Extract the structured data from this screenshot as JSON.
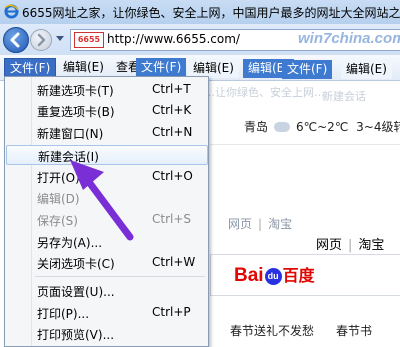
{
  "window": {
    "title": "6655网址之家，让你绿色、安全上网，中国用户最多的网址大全网站之一"
  },
  "addressbar": {
    "favicon_text": "6655",
    "url": "http://www.6655.com/",
    "watermark": "win7china.com"
  },
  "menubar": {
    "file": "文件(F)",
    "edit": "编辑(E)",
    "view": "查看",
    "ghost_file": "文件(F)",
    "ghost_edit_1": "编辑(E)",
    "ghost_edit_2": "编辑(E)",
    "ghost_file_2": "文件(F)",
    "ghost_edit_3": "编辑(E)"
  },
  "file_menu": {
    "items": [
      {
        "label": "新建选项卡(T)",
        "shortcut": "Ctrl+T",
        "disabled": false
      },
      {
        "label": "重复选项卡(B)",
        "shortcut": "Ctrl+K",
        "disabled": false
      },
      {
        "label": "新建窗口(N)",
        "shortcut": "Ctrl+N",
        "disabled": false
      },
      {
        "label": "新建会话(I)",
        "shortcut": "",
        "disabled": false,
        "highlighted": true
      },
      {
        "label": "打开(O)...",
        "shortcut": "Ctrl+O",
        "disabled": false
      },
      {
        "label": "编辑(D)",
        "shortcut": "",
        "disabled": true
      },
      {
        "label": "保存(S)",
        "shortcut": "Ctrl+S",
        "disabled": true
      },
      {
        "label": "另存为(A)...",
        "shortcut": "",
        "disabled": false
      },
      {
        "label": "关闭选项卡(C)",
        "shortcut": "Ctrl+W",
        "disabled": false
      },
      {
        "label": "页面设置(U)...",
        "shortcut": "",
        "disabled": false
      },
      {
        "label": "打印(P)...",
        "shortcut": "Ctrl+P",
        "disabled": false
      },
      {
        "label": "打印预览(V)...",
        "shortcut": "",
        "disabled": false
      }
    ]
  },
  "page": {
    "faint_text_1": "…让你绿色、安全上网…",
    "faint_text_2": "新建会话",
    "weather_city": "青岛",
    "weather_temp": "6℃~2℃",
    "weather_wind": "3~4级转",
    "tab_web_faint": "网页",
    "tab_taobao_faint": "淘宝",
    "tab_web": "网页",
    "tab_taobao": "淘宝",
    "baidu_logo_left": "Bai",
    "baidu_logo_paw": "du",
    "baidu_logo_right": "百度",
    "bottom_link_1": "春节送礼不发愁",
    "bottom_link_2": "春节书"
  },
  "colors": {
    "menu_highlight": "#e5effb",
    "menubar_active": "#3a6fc5",
    "arrow": "#7a2fd6",
    "baidu_red": "#e10602",
    "baidu_blue": "#2932e1"
  }
}
